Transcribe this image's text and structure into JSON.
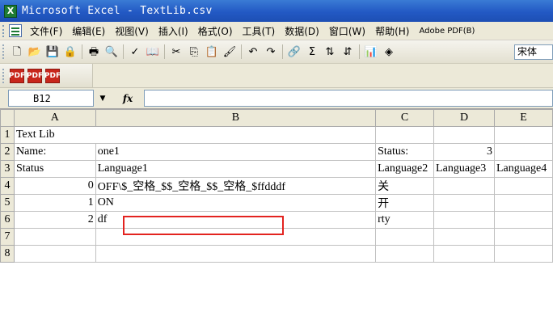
{
  "window": {
    "app_icon": "excel-icon",
    "title": "Microsoft Excel - TextLib.csv"
  },
  "menu": {
    "items": [
      "文件(F)",
      "编辑(E)",
      "视图(V)",
      "插入(I)",
      "格式(O)",
      "工具(T)",
      "数据(D)",
      "窗口(W)",
      "帮助(H)",
      "Adobe PDF(B)"
    ]
  },
  "toolbar": {
    "buttons": [
      {
        "name": "new-icon",
        "glyph": "🗋"
      },
      {
        "name": "open-icon",
        "glyph": "📂"
      },
      {
        "name": "save-icon",
        "glyph": "💾"
      },
      {
        "name": "permission-icon",
        "glyph": "🔒"
      },
      {
        "name": "print-icon",
        "glyph": "🖶"
      },
      {
        "name": "print-preview-icon",
        "glyph": "🔍"
      },
      {
        "name": "spelling-icon",
        "glyph": "✓"
      },
      {
        "name": "research-icon",
        "glyph": "📖"
      },
      {
        "name": "cut-icon",
        "glyph": "✂"
      },
      {
        "name": "copy-icon",
        "glyph": "⎘"
      },
      {
        "name": "paste-icon",
        "glyph": "📋"
      },
      {
        "name": "format-painter-icon",
        "glyph": "🖌"
      },
      {
        "name": "undo-icon",
        "glyph": "↶"
      },
      {
        "name": "redo-icon",
        "glyph": "↷"
      },
      {
        "name": "hyperlink-icon",
        "glyph": "🔗"
      },
      {
        "name": "autosum-icon",
        "glyph": "Σ"
      },
      {
        "name": "sort-ascending-icon",
        "glyph": "⇅"
      },
      {
        "name": "sort-descending-icon",
        "glyph": "⇵"
      },
      {
        "name": "chart-wizard-icon",
        "glyph": "📊"
      },
      {
        "name": "drawing-icon",
        "glyph": "◈"
      }
    ],
    "font_name": "宋体"
  },
  "pdf_toolbar": {
    "buttons": [
      "PDF",
      "PDF",
      "PDF"
    ]
  },
  "formula_bar": {
    "name_box": "B12",
    "fx_label": "fx",
    "formula": ""
  },
  "sheet": {
    "columns": [
      "A",
      "B",
      "C",
      "D",
      "E"
    ],
    "rows": [
      {
        "num": "1",
        "cells": [
          "Text Lib",
          "",
          "",
          "",
          ""
        ]
      },
      {
        "num": "2",
        "cells": [
          "Name:",
          "one1",
          "Status:",
          "3",
          ""
        ]
      },
      {
        "num": "3",
        "cells": [
          "Status",
          "Language1",
          "Language2",
          "Language3",
          "Language4"
        ]
      },
      {
        "num": "4",
        "cells": [
          "0",
          "OFF\\$_空格_$$_空格_$$_空格_$ffdddf",
          "关",
          "",
          ""
        ]
      },
      {
        "num": "5",
        "cells": [
          "1",
          "ON",
          "开",
          "",
          ""
        ]
      },
      {
        "num": "6",
        "cells": [
          "2",
          "df",
          "rty",
          "",
          ""
        ]
      },
      {
        "num": "7",
        "cells": [
          "",
          "",
          "",
          "",
          ""
        ]
      },
      {
        "num": "8",
        "cells": [
          "",
          "",
          "",
          "",
          ""
        ]
      }
    ]
  },
  "colors": {
    "title_bar": "#2359c4",
    "highlight_box": "#e3231f",
    "excel_green": "#1e7b34"
  }
}
